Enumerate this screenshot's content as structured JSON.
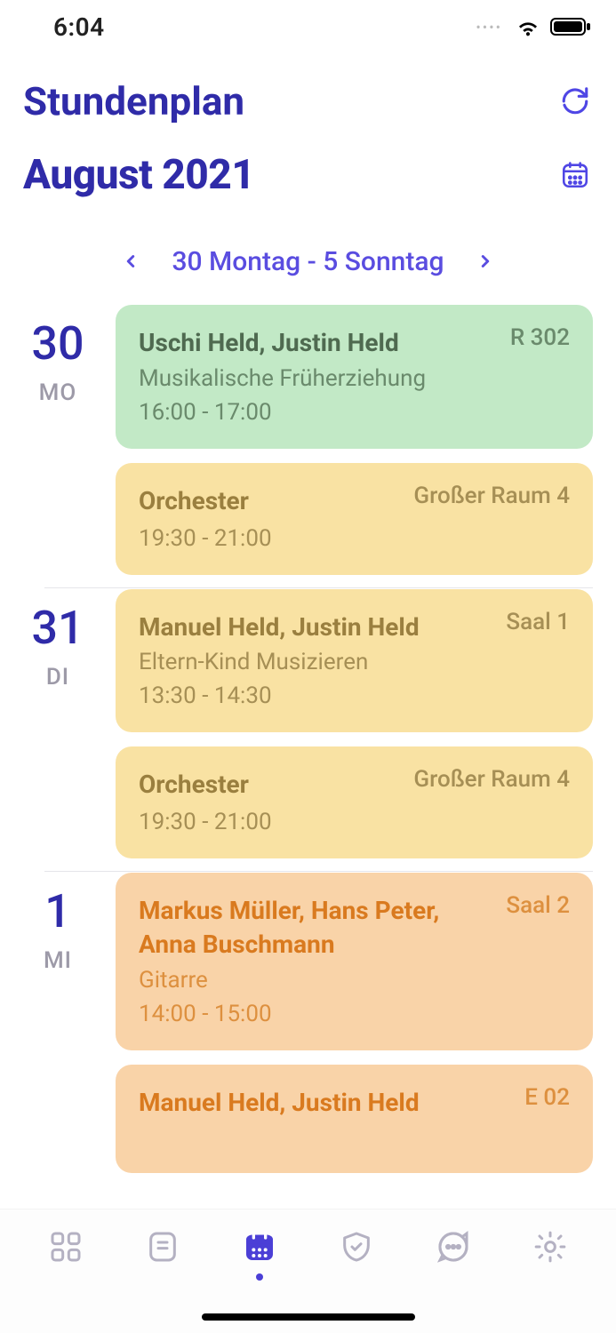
{
  "status": {
    "time": "6:04"
  },
  "header": {
    "title": "Stundenplan",
    "month": "August 2021",
    "week_range": "30 Montag - 5 Sonntag"
  },
  "days": [
    {
      "num": "30",
      "abbr": "MO",
      "events": [
        {
          "color": "green",
          "title": "Uschi Held, Justin Held",
          "subtitle": "Musikalische Früherziehung",
          "time": "16:00 - 17:00",
          "room": "R 302"
        },
        {
          "color": "yellow",
          "title": "Orchester",
          "subtitle": "",
          "time": "19:30 - 21:00",
          "room": "Großer Raum 4"
        }
      ]
    },
    {
      "num": "31",
      "abbr": "DI",
      "events": [
        {
          "color": "yellow",
          "title": "Manuel Held, Justin Held",
          "subtitle": "Eltern-Kind Musizieren",
          "time": "13:30 - 14:30",
          "room": "Saal 1"
        },
        {
          "color": "yellow",
          "title": "Orchester",
          "subtitle": "",
          "time": "19:30 - 21:00",
          "room": "Großer Raum 4"
        }
      ]
    },
    {
      "num": "1",
      "abbr": "MI",
      "events": [
        {
          "color": "orange",
          "title": "Markus Müller, Hans Peter, Anna Buschmann",
          "subtitle": "Gitarre",
          "time": "14:00 - 15:00",
          "room": "Saal 2"
        },
        {
          "color": "orange",
          "title": "Manuel Held, Justin Held",
          "subtitle": "",
          "time": "",
          "room": "E 02"
        }
      ]
    }
  ]
}
